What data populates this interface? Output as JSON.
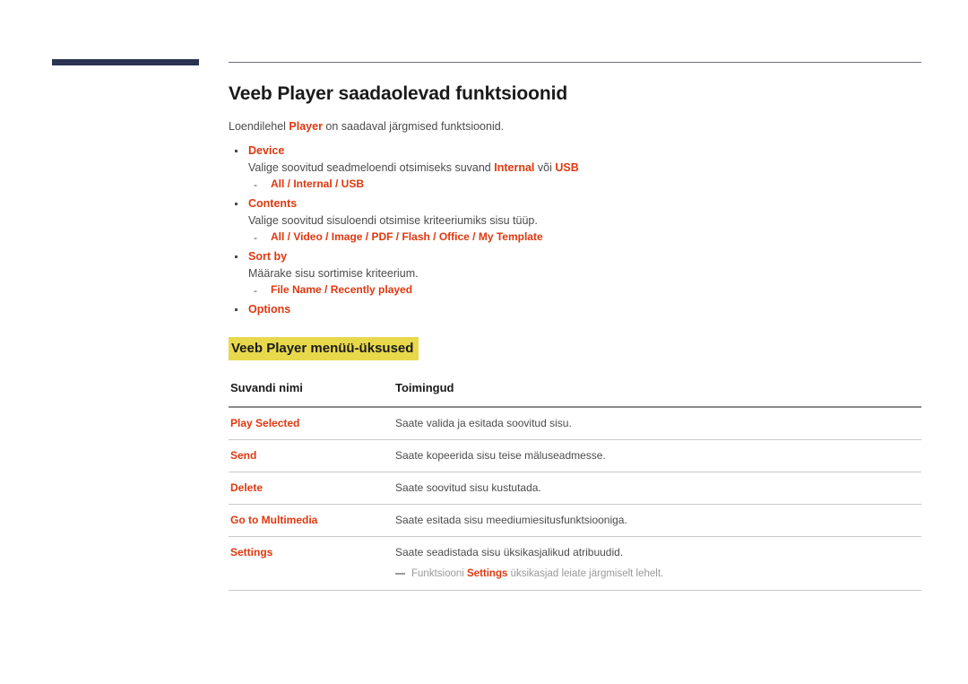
{
  "document": {
    "title": "Veeb Player saadaolevad funktsioonid",
    "intro_before": "Loendilehel ",
    "intro_accent": "Player",
    "intro_after": " on saadaval järgmised funktsioonid."
  },
  "features": [
    {
      "label": "Device",
      "desc_before": "Valige soovitud seadmeloendi otsimiseks suvand ",
      "desc_accent1": "Internal",
      "desc_mid": " või ",
      "desc_accent2": "USB",
      "desc_after": "",
      "options": "All / Internal / USB"
    },
    {
      "label": "Contents",
      "desc_before": "Valige soovitud sisuloendi otsimise kriteeriumiks sisu tüüp.",
      "desc_accent1": "",
      "desc_mid": "",
      "desc_accent2": "",
      "desc_after": "",
      "options": "All / Video / Image / PDF / Flash / Office / My Template"
    },
    {
      "label": "Sort by",
      "desc_before": "Määrake sisu sortimise kriteerium.",
      "desc_accent1": "",
      "desc_mid": "",
      "desc_accent2": "",
      "desc_after": "",
      "options": "File Name / Recently played"
    },
    {
      "label": "Options",
      "desc_before": "",
      "desc_accent1": "",
      "desc_mid": "",
      "desc_accent2": "",
      "desc_after": "",
      "options": ""
    }
  ],
  "section": {
    "heading": "Veeb Player menüü-üksused",
    "highlight_color": "#e8d94c"
  },
  "table": {
    "headers": {
      "name": "Suvandi nimi",
      "action": "Toimingud"
    },
    "rows": [
      {
        "name": "Play Selected",
        "action": "Saate valida ja esitada soovitud sisu.",
        "note": null
      },
      {
        "name": "Send",
        "action": "Saate kopeerida sisu teise mäluseadmesse.",
        "note": null
      },
      {
        "name": "Delete",
        "action": "Saate soovitud sisu kustutada.",
        "note": null
      },
      {
        "name": "Go to Multimedia",
        "action": "Saate esitada sisu meediumiesitusfunktsiooniga.",
        "note": null
      },
      {
        "name": "Settings",
        "action": "Saate seadistada sisu üksikasjalikud atribuudid.",
        "note": {
          "before": "Funktsiooni ",
          "accent": "Settings",
          "after": " üksikasjad leiate järgmiselt lehelt."
        }
      }
    ]
  },
  "colors": {
    "accent": "#e0380f",
    "navy_rule": "#2b3352",
    "gray_rule": "#6f6f81",
    "highlight": "#e8d94c",
    "body_text": "#4b4b4b"
  }
}
